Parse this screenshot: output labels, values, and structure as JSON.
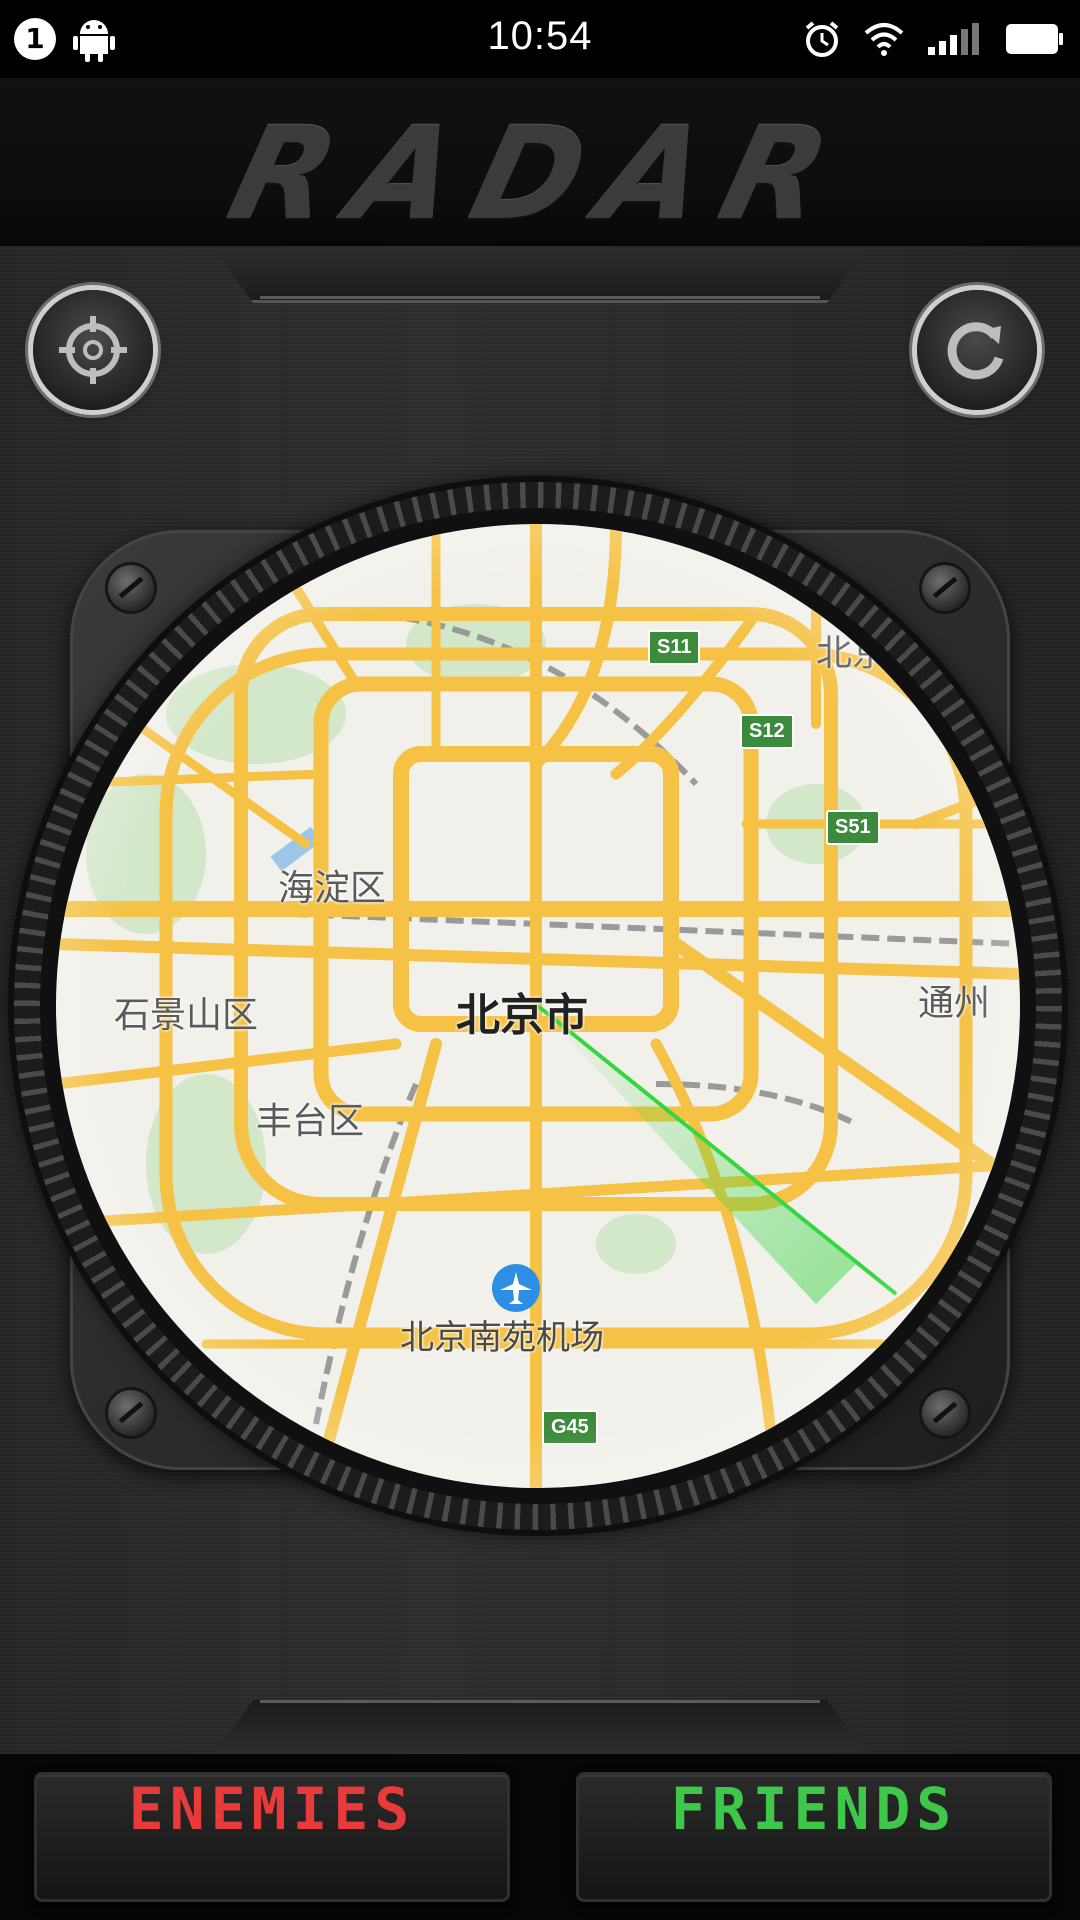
{
  "status_bar": {
    "notification_count": "1",
    "time": "10:54",
    "icons": [
      "android-icon",
      "alarm-icon",
      "wifi-icon",
      "signal-icon",
      "battery-icon"
    ]
  },
  "header": {
    "title": "RADAR"
  },
  "controls": {
    "left_button_icon": "crosshair-icon",
    "right_button_icon": "refresh-icon"
  },
  "map": {
    "city": "北京市",
    "districts": [
      "海淀区",
      "石景山区",
      "丰台区",
      "通州",
      "北京国际机"
    ],
    "airport": "北京南苑机场",
    "road_shields": [
      "S11",
      "S12",
      "S51",
      "G45"
    ]
  },
  "bottom_bar": {
    "enemies_label": "ENEMIES",
    "friends_label": "FRIENDS"
  },
  "colors": {
    "enemies": "#e83a3a",
    "friends": "#3ec84a",
    "radar_sweep": "#35d63f",
    "road": "#f5c246",
    "shield": "#3c8a3c"
  }
}
